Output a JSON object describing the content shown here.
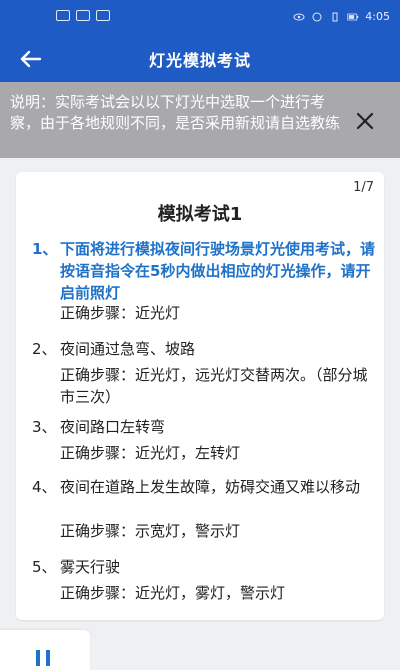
{
  "status": {
    "time": "4:05"
  },
  "header": {
    "title": "灯光模拟考试"
  },
  "notice": {
    "text": "说明：实际考试会以以下灯光中选取一个进行考察，由于各地规则不同，是否采用新规请自选教练"
  },
  "exam": {
    "counter": "1/7",
    "title": "模拟考试1",
    "questions": [
      {
        "num": "1、",
        "text": "下面将进行模拟夜间行驶场景灯光使用考试，请按语音指令在5秒内做出相应的灯光操作，请开启前照灯",
        "step": "正确步骤：近光灯"
      },
      {
        "num": "2、",
        "text": "夜间通过急弯、坡路",
        "step": "正确步骤：近光灯，远光灯交替两次。（部分城市三次）"
      },
      {
        "num": "3、",
        "text": "夜间路口左转弯",
        "step": "正确步骤：近光灯，左转灯"
      },
      {
        "num": "4、",
        "text": "夜间在道路上发生故障，妨碍交通又难以移动",
        "step": "正确步骤：示宽灯，警示灯"
      },
      {
        "num": "5、",
        "text": "雾天行驶",
        "step": "正确步骤：近光灯，雾灯，警示灯"
      }
    ]
  },
  "colors": {
    "primary": "#1f5bc4",
    "accent": "#1f72c8",
    "notice_bg": "#a9a9ad"
  }
}
